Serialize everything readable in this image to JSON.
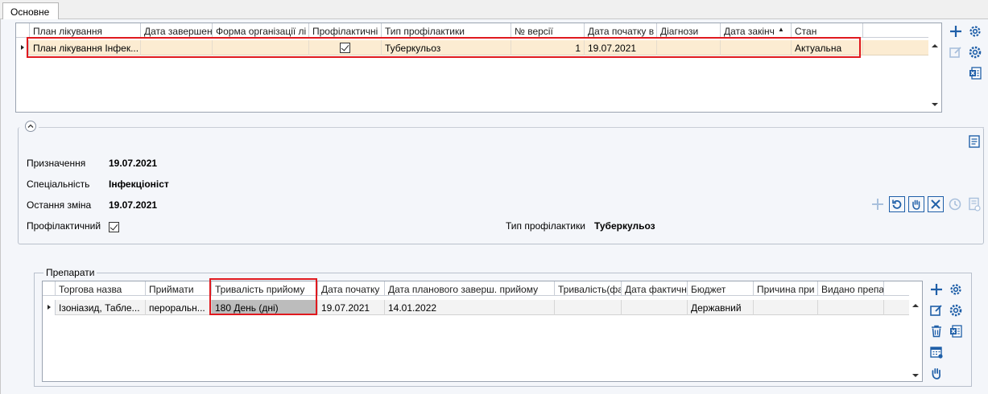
{
  "tab": {
    "label": "Основне"
  },
  "top_grid": {
    "columns": [
      "План лікування",
      "Дата завершен",
      "Форма організації лі",
      "Профілактичні",
      "Тип профілактики",
      "№ версії",
      "Дата початку в",
      "Діагнози",
      "Дата закінч",
      "Стан"
    ],
    "sort_indicator": "▲",
    "row": {
      "plan": "План лікування Інфек...",
      "end_date": "",
      "form": "",
      "preventive": true,
      "prevention_type": "Туберкульоз",
      "version": "1",
      "start_date": "19.07.2021",
      "diagnoses": "",
      "finish_date": "",
      "state": "Актуальна"
    }
  },
  "details": {
    "appointment_label": "Призначення",
    "appointment_value": "19.07.2021",
    "specialty_label": "Спеціальність",
    "specialty_value": "Інфекціоніст",
    "last_change_label": "Остання зміна",
    "last_change_value": "19.07.2021",
    "preventive_label": "Профілактичний",
    "preventive_checked": true,
    "prevention_type_label": "Тип профілактики",
    "prevention_type_value": "Туберкульоз"
  },
  "drugs": {
    "title": "Препарати",
    "columns": [
      "Торгова назва",
      "Приймати",
      "Тривалість прийому",
      "Дата початку",
      "Дата планового заверш. прийому",
      "Тривалість(фа",
      "Дата фактичн",
      "Бюджет",
      "Причина при",
      "Видано препа"
    ],
    "row": {
      "trade_name": "Ізоніазид, Табле...",
      "take": "пероральн...",
      "duration": "180 День (дні)",
      "start": "19.07.2021",
      "planned_end": "14.01.2022",
      "duration_fact": "",
      "fact_date": "",
      "budget": "Державний",
      "reason": "",
      "issued": ""
    }
  },
  "colors": {
    "selected_row": "#fcecd2",
    "highlight_border": "#e0191e",
    "icon_blue": "#1f5fa8",
    "icon_disabled": "#a9c0dc"
  },
  "icons": [
    "add-icon",
    "settings-icon",
    "edit-icon",
    "grid-settings-icon",
    "excel-export-icon",
    "print-icon",
    "restore-icon",
    "hand-icon",
    "delete-icon",
    "history-icon",
    "document-icon",
    "trash-icon",
    "calendar-icon",
    "collapse-icon"
  ]
}
